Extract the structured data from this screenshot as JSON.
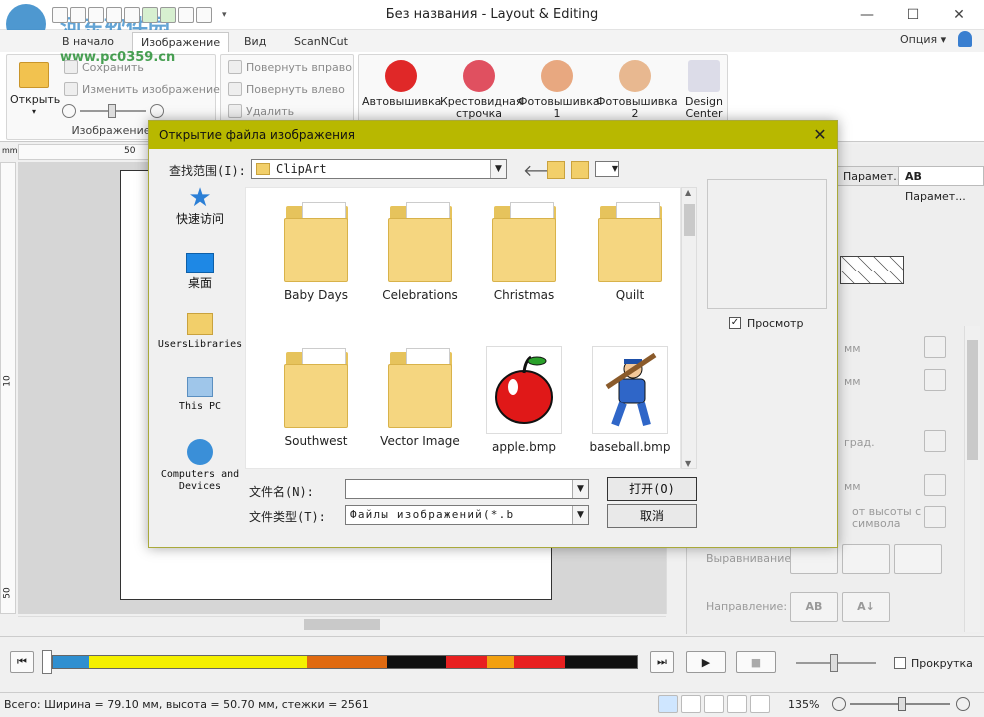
{
  "window": {
    "title": "Без названия - Layout & Editing",
    "watermark_line1": "河东软件园",
    "watermark_line2": "www.pc0359.cn",
    "option_label": "Опция"
  },
  "tabs": [
    "В начало",
    "Изображение",
    "Вид",
    "ScanNCut"
  ],
  "ribbon": {
    "open_label": "Открыть",
    "save_label": "Сохранить",
    "change_image_label": "Изменить изображение",
    "rotate_right_label": "Повернуть вправо",
    "rotate_left_label": "Повернуть влево",
    "delete_label": "Удалить",
    "group_image_label": "Изображение",
    "auto_label": "Автовышивка",
    "cross_label1": "Крестовидная",
    "cross_label2": "строчка",
    "photo1_label1": "Фотовышивка",
    "photo1_label2": "1",
    "photo2_label1": "Фотовышивка",
    "photo2_label2": "2",
    "design_label1": "Design",
    "design_label2": "Center"
  },
  "ruler": {
    "unit": "mm",
    "mark50": "50",
    "v10": "10",
    "v50": "50"
  },
  "right_panel": {
    "tab1": "Парамет...",
    "tab2_prefix": "AB",
    "tab2": "Парамет...",
    "mm1": "мм",
    "mm2": "мм",
    "grad": "град.",
    "mm3": "мм",
    "height_note1": "от высоты с",
    "height_note2": "символа",
    "align_label": "Выравнивание:",
    "direction_label": "Направление:",
    "dir1": "AB",
    "dir2": "A↓"
  },
  "colors": [
    "#2f8fd0",
    "#f4f000",
    "#e06a10",
    "#111111",
    "#e82020",
    "#f2a010",
    "#e82020",
    "#111111"
  ],
  "color_widths": [
    35,
    212,
    78,
    58,
    40,
    26,
    50,
    70
  ],
  "playback": {
    "loop_label": "Прокрутка",
    "loop_checked": false
  },
  "status": {
    "text": "Всего: Ширина = 79.10 мм, высота = 50.70 мм, стежки = 2561",
    "zoom": "135%"
  },
  "dialog": {
    "title": "Открытие файла изображения",
    "lookin_label": "查找范围(I):",
    "lookin_value": "ClipArt",
    "places": [
      "快速访问",
      "桌面",
      "UsersLibraries",
      "This PC",
      "Computers and Devices"
    ],
    "files": [
      {
        "name": "Baby Days",
        "kind": "folder"
      },
      {
        "name": "Celebrations",
        "kind": "folder"
      },
      {
        "name": "Christmas",
        "kind": "folder"
      },
      {
        "name": "Quilt",
        "kind": "folder"
      },
      {
        "name": "Southwest",
        "kind": "folder"
      },
      {
        "name": "Vector Image",
        "kind": "folder"
      },
      {
        "name": "apple.bmp",
        "kind": "image"
      },
      {
        "name": "baseball.bmp",
        "kind": "image"
      }
    ],
    "filename_label": "文件名(N):",
    "filename_value": "",
    "filetype_label": "文件类型(T):",
    "filetype_value": "Файлы изображений(*.b",
    "open_btn": "打开(O)",
    "cancel_btn": "取消",
    "preview_label": "Просмотр",
    "preview_checked": true
  }
}
